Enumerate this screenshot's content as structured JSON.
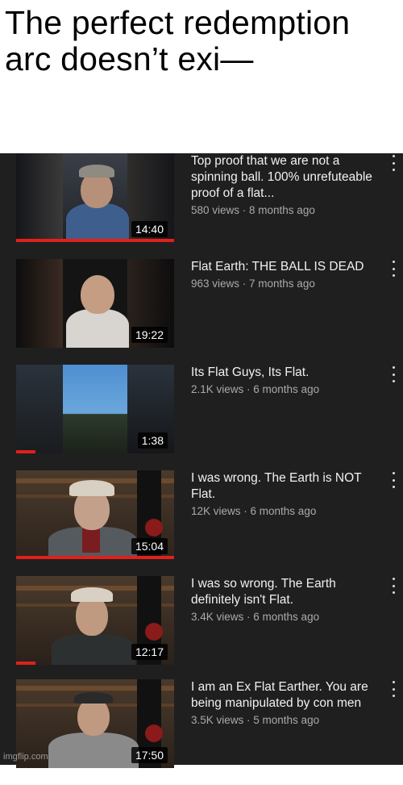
{
  "caption": "The perfect redemption arc doesn’t exi—",
  "watermark": "imgflip.com",
  "colors": {
    "feed_bg": "#1f1f1f",
    "progress": "#e0201b",
    "title": "#f1f1f1",
    "meta": "#aaaaaa"
  },
  "videos": [
    {
      "title": "Top proof that we are not a spinning ball. 100% unrefuteable proof of a flat...",
      "stats": "580 views · 8 months ago",
      "duration": "14:40",
      "watched_fraction": 1.0
    },
    {
      "title": "Flat Earth: THE BALL IS DEAD",
      "stats": "963 views · 7 months ago",
      "duration": "19:22",
      "watched_fraction": 0.0
    },
    {
      "title": "Its Flat Guys, Its Flat.",
      "stats": "2.1K views · 6 months ago",
      "duration": "1:38",
      "watched_fraction": 0.12
    },
    {
      "title": "I was wrong. The Earth is NOT Flat.",
      "stats": "12K views · 6 months ago",
      "duration": "15:04",
      "watched_fraction": 1.0
    },
    {
      "title": "I was so wrong. The Earth definitely isn't Flat.",
      "stats": "3.4K views · 6 months ago",
      "duration": "12:17",
      "watched_fraction": 0.12
    },
    {
      "title": "I am an Ex Flat Earther. You are being manipulated by con men",
      "stats": "3.5K views · 5 months ago",
      "duration": "17:50",
      "watched_fraction": 0.0
    }
  ],
  "icons": {
    "menu": "more-vert-icon"
  }
}
